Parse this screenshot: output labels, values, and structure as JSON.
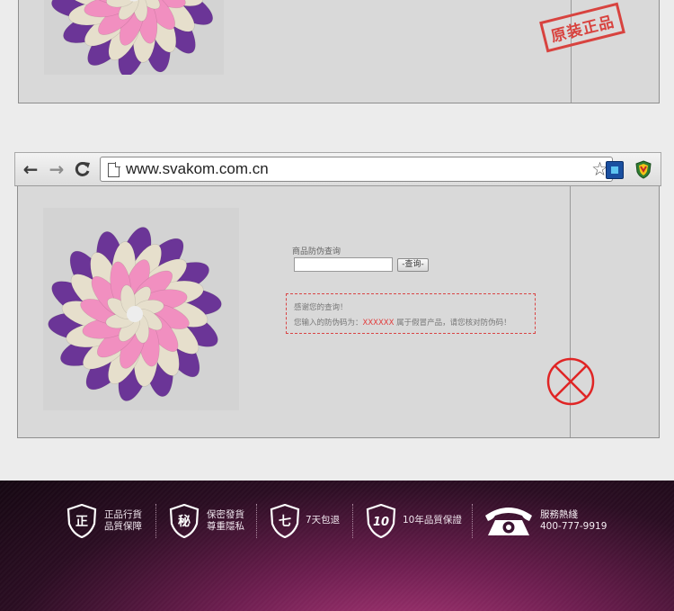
{
  "top_panel": {
    "stamp_text": "原装正品"
  },
  "browser": {
    "back_icon": "←",
    "forward_icon": "→",
    "reload_icon": "C",
    "url": "www.svakom.com.cn",
    "star_icon": "☆"
  },
  "query": {
    "label": "商品防伪查询",
    "input_value": "",
    "button_label": "-查询-"
  },
  "result": {
    "line1": "感谢您的查询！",
    "line2_prefix": "您输入的防伪码为：",
    "code": "XXXXXX",
    "line2_suffix": " 属于假冒产品，请您核对防伪码！"
  },
  "footer": {
    "features": [
      {
        "icon_char": "正",
        "line1": "正品行貨",
        "line2": "品質保障"
      },
      {
        "icon_char": "秘",
        "line1": "保密發貨",
        "line2": "尊重隱私"
      },
      {
        "icon_char": "七",
        "line1": "7天包退"
      },
      {
        "icon_char": "10",
        "line1": "10年品質保證"
      }
    ],
    "hotline_label": "服務熱綫",
    "hotline_number": "400-777-9919"
  },
  "colors": {
    "stamp_red": "#d8433f",
    "cross_red": "#e02525",
    "flower_purple": "#6b3597",
    "flower_pink": "#f18fc0",
    "flower_cream": "#e6dfcc",
    "footer_magenta": "#8a2a65"
  }
}
